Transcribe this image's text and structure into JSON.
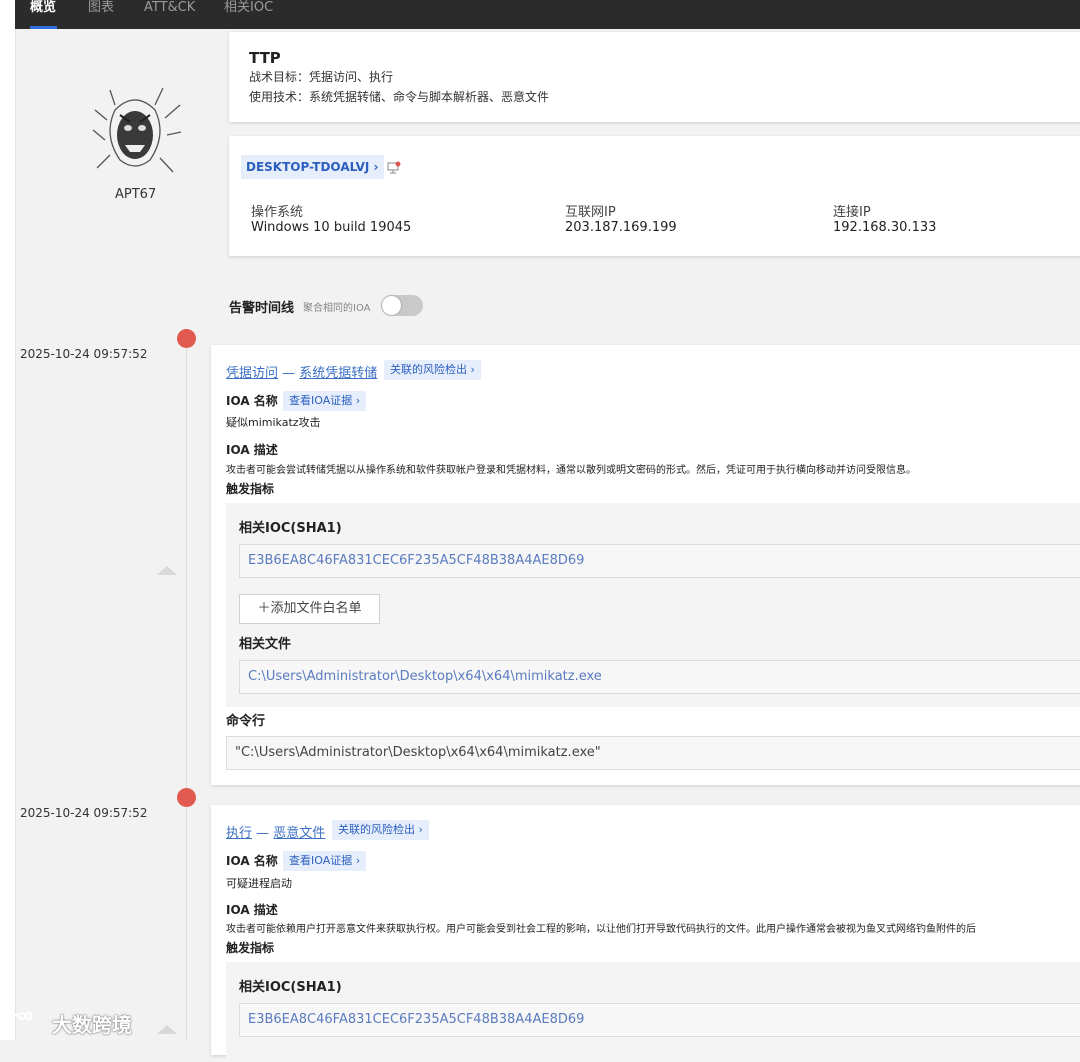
{
  "nav": {
    "tabs": [
      "概览",
      "图表",
      "ATT&CK",
      "相关IOC"
    ]
  },
  "actor": {
    "name": "APT67"
  },
  "ttp": {
    "title": "TTP",
    "tactics_label": "战术目标：",
    "tactics_value": "凭据访问、执行",
    "techniques_label": "使用技术：",
    "techniques_value": "系统凭据转储、命令与脚本解析器、恶意文件"
  },
  "host": {
    "name": "DESKTOP-TDOALVJ",
    "chevron": "›",
    "os_label": "操作系统",
    "os_value": "Windows 10 build 19045",
    "internet_ip_label": "互联网IP",
    "internet_ip_value": "203.187.169.199",
    "connect_ip_label": "连接IP",
    "connect_ip_value": "192.168.30.133"
  },
  "timeline": {
    "title": "告警时间线",
    "aggregate_label": "聚合相同的IOA",
    "aggregate_enabled": false
  },
  "alerts": [
    {
      "time": "2025-10-24 09:57:52",
      "tactic": "凭据访问",
      "dash": "—",
      "technique": "系统凭据转储",
      "risk_button": "关联的风险检出 ›",
      "ioa_name_label": "IOA 名称",
      "ioa_evidence_button": "查看IOA证据 ›",
      "ioa_name": "疑似mimikatz攻击",
      "ioa_desc_label": "IOA 描述",
      "ioa_desc": "攻击者可能会尝试转储凭据以从操作系统和软件获取帐户登录和凭据材料，通常以散列或明文密码的形式。然后，凭证可用于执行横向移动并访问受限信息。",
      "trigger_label": "触发指标",
      "ioc_label": "相关IOC(SHA1)",
      "ioc_value": "E3B6EA8C46FA831CEC6F235A5CF48B38A4AE8D69",
      "whitelist_button": "＋添加文件白名单",
      "file_label": "相关文件",
      "file_value": "C:\\Users\\Administrator\\Desktop\\x64\\x64\\mimikatz.exe",
      "cmd_label": "命令行",
      "cmd_value": "\"C:\\Users\\Administrator\\Desktop\\x64\\x64\\mimikatz.exe\""
    },
    {
      "time": "2025-10-24 09:57:52",
      "tactic": "执行",
      "dash": "—",
      "technique": "恶意文件",
      "risk_button": "关联的风险检出 ›",
      "ioa_name_label": "IOA 名称",
      "ioa_evidence_button": "查看IOA证据 ›",
      "ioa_name": "可疑进程启动",
      "ioa_desc_label": "IOA 描述",
      "ioa_desc": "攻击者可能依赖用户打开恶意文件来获取执行权。用户可能会受到社会工程的影响，以让他们打开导致代码执行的文件。此用户操作通常会被视为鱼叉式网络钓鱼附件的后",
      "trigger_label": "触发指标",
      "ioc_label": "相关IOC(SHA1)",
      "ioc_value": "E3B6EA8C46FA831CEC6F235A5CF48B38A4AE8D69"
    }
  ],
  "watermark": {
    "text": "大数跨境"
  },
  "colors": {
    "alert_dot": "#e05a50",
    "link": "#3b6fc4",
    "accent": "#2f6fe0"
  }
}
